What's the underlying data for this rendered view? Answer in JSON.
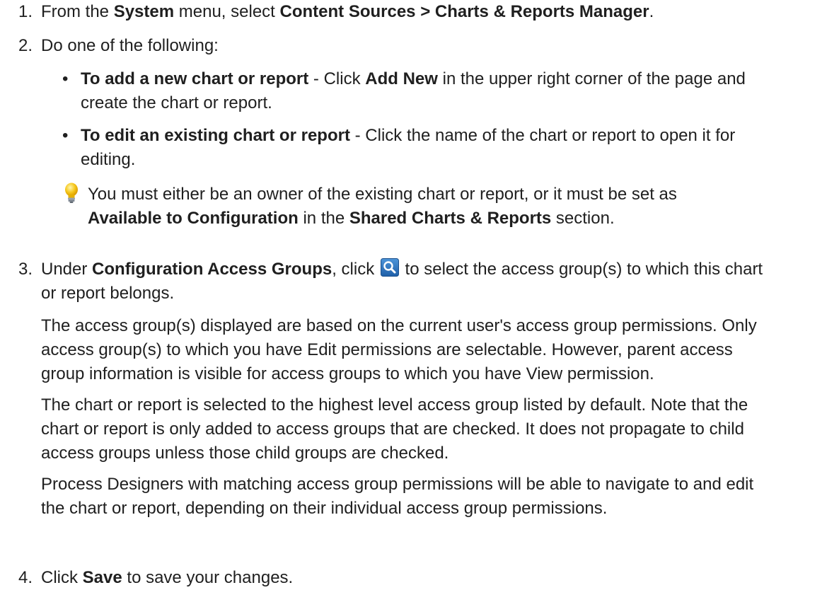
{
  "steps": [
    {
      "number": "1.",
      "pre": "From the ",
      "b1": "System",
      "mid": " menu, select ",
      "b2": "Content Sources > Charts & Reports Manager",
      "post": "."
    },
    {
      "number": "2.",
      "text": "Do one of the following:",
      "bullets": [
        {
          "bold": "To add a new chart or report",
          "pre": " - Click ",
          "bold2": "Add New",
          "post": " in the upper right corner of the page and",
          "line2": "create the chart or report."
        },
        {
          "bold": "To edit an existing chart or report",
          "post": " - Click the name of the chart or report to open it for",
          "line2": "editing."
        }
      ],
      "tip": {
        "line1": "You must either be an owner of the existing chart or report, or it must be set as",
        "b1": "Available to Configuration",
        "mid": " in the ",
        "b2": "Shared Charts & Reports",
        "post": " section."
      }
    },
    {
      "number": "3.",
      "pre": "Under ",
      "bold": "Configuration Access Groups",
      "mid": ", click ",
      "post": " to select the access group(s) to which this chart",
      "line2": "or report belongs.",
      "paragraphs": [
        [
          "The access group(s) displayed are based on the current user's access group permissions. Only",
          "access group(s) to which you have Edit permissions are selectable. However, parent access",
          "group information is visible for access groups to which you have View permission."
        ],
        [
          "The chart or report is selected to the highest level access group listed by default. Note that the",
          "chart or report is only added to access groups that are checked. It does not propagate to child",
          "access groups unless those child groups are checked."
        ],
        [
          "Process Designers with matching access group permissions will be able to navigate to and edit",
          "the chart or report, depending on their individual access group permissions."
        ]
      ]
    },
    {
      "number": "4.",
      "pre": "Click ",
      "bold": "Save",
      "post": " to save your changes."
    }
  ],
  "icons": {
    "search": "search-icon",
    "tip": "lightbulb-icon"
  },
  "colors": {
    "text": "#1f1f1f",
    "icon_blue": "#2a6fb8",
    "bulb": "#f5c518"
  }
}
